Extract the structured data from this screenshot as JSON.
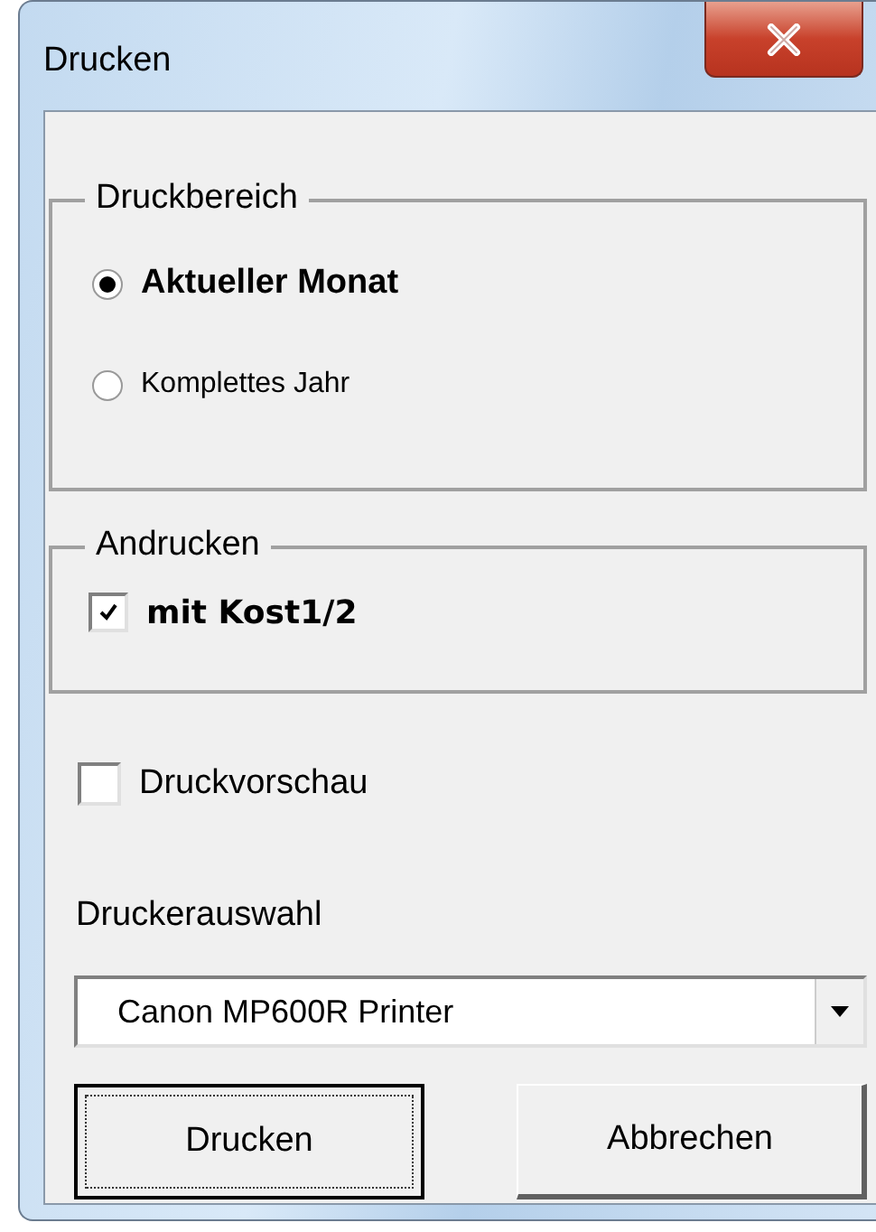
{
  "window": {
    "title": "Drucken"
  },
  "print_range": {
    "legend": "Druckbereich",
    "options": [
      {
        "label": "Aktueller Monat",
        "selected": true
      },
      {
        "label": "Komplettes Jahr",
        "selected": false
      }
    ]
  },
  "print_extras": {
    "legend": "Andrucken",
    "options": [
      {
        "label": "mit Kost1/2",
        "checked": true
      }
    ]
  },
  "preview": {
    "label": "Druckvorschau",
    "checked": false
  },
  "printer": {
    "label": "Druckerauswahl",
    "value": "Canon MP600R Printer"
  },
  "buttons": [
    {
      "label": "Drucken",
      "focused": true
    },
    {
      "label": "Abbrechen",
      "focused": false
    }
  ]
}
